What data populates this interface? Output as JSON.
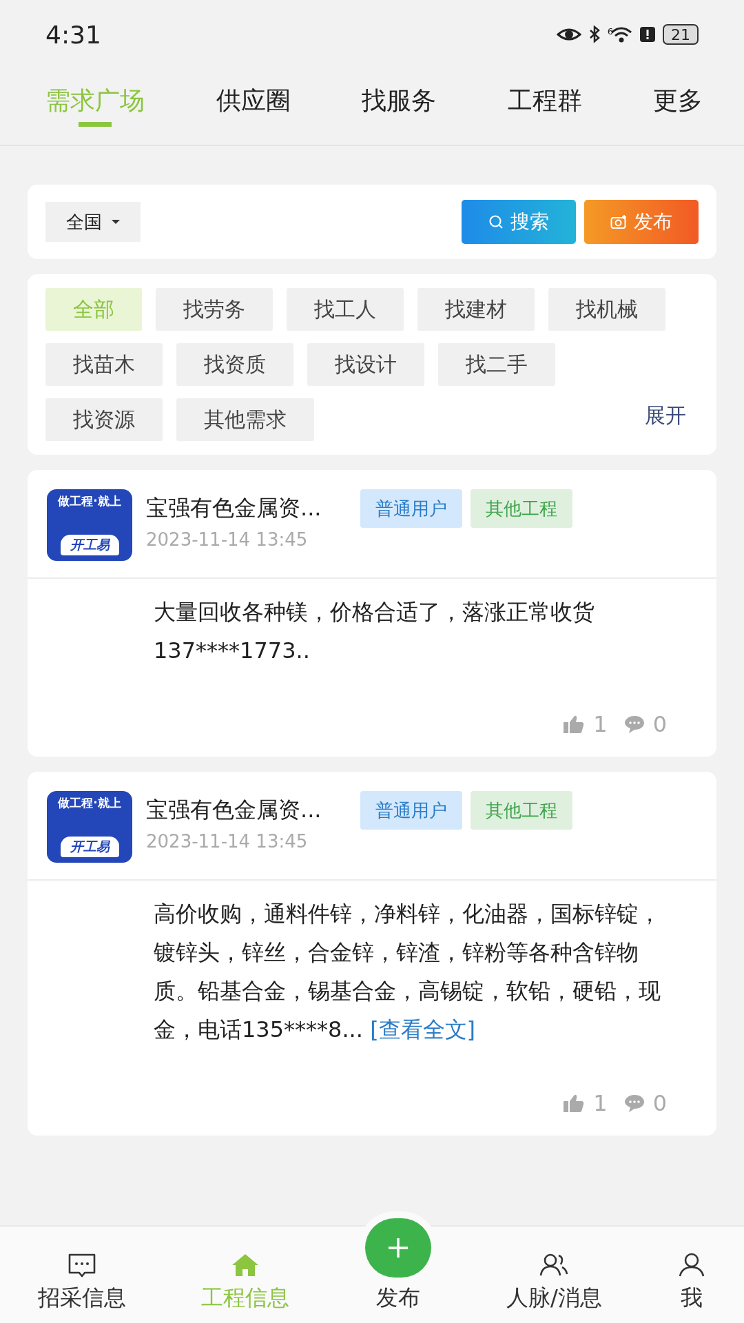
{
  "status_bar": {
    "time": "4:31",
    "battery": "21",
    "signal_badge": "6"
  },
  "tabs": [
    {
      "label": "需求广场",
      "selected": true
    },
    {
      "label": "供应圈",
      "selected": false
    },
    {
      "label": "找服务",
      "selected": false
    },
    {
      "label": "工程群",
      "selected": false
    },
    {
      "label": "更多",
      "selected": false
    }
  ],
  "filter": {
    "region": "全国",
    "search_button": "搜索",
    "publish_button": "发布"
  },
  "categories": [
    {
      "label": "全部",
      "selected": true
    },
    {
      "label": "找劳务",
      "selected": false
    },
    {
      "label": "找工人",
      "selected": false
    },
    {
      "label": "找建材",
      "selected": false
    },
    {
      "label": "找机械",
      "selected": false
    },
    {
      "label": "找苗木",
      "selected": false
    },
    {
      "label": "找资质",
      "selected": false
    },
    {
      "label": "找设计",
      "selected": false
    },
    {
      "label": "找二手",
      "selected": false
    },
    {
      "label": "找资源",
      "selected": false
    },
    {
      "label": "其他需求",
      "selected": false
    }
  ],
  "expand_link": "展开",
  "posts": [
    {
      "logo_top": "做工程·就上",
      "logo_bottom": "开工易",
      "name": "宝强有色金属资...",
      "date": "2023-11-14 13:45",
      "tags": [
        {
          "label": "普通用户",
          "kind": "user"
        },
        {
          "label": "其他工程",
          "kind": "category"
        }
      ],
      "text": "大量回收各种镁，价格合适了，落涨正常收货137****1773..",
      "likes": "1",
      "comments": "0"
    },
    {
      "logo_top": "做工程·就上",
      "logo_bottom": "开工易",
      "name": "宝强有色金属资...",
      "date": "2023-11-14 13:45",
      "tags": [
        {
          "label": "普通用户",
          "kind": "user"
        },
        {
          "label": "其他工程",
          "kind": "category"
        }
      ],
      "text": "高价收购，通料件锌，净料锌，化油器，国标锌锭，镀锌头，锌丝，合金锌，锌渣，锌粉等各种含锌物质。铅基合金，锡基合金，高锡锭，软铅，硬铅，现金，电话135****8...",
      "link": "[查看全文]",
      "likes": "1",
      "comments": "0"
    }
  ],
  "bottom_nav": [
    {
      "label": "招采信息",
      "kind": "chat",
      "selected": false
    },
    {
      "label": "工程信息",
      "kind": "home",
      "selected": true
    },
    {
      "label": "发布",
      "kind": "plus",
      "selected": false
    },
    {
      "label": "人脉/消息",
      "kind": "people",
      "selected": false
    },
    {
      "label": "我",
      "kind": "person",
      "selected": false
    }
  ]
}
